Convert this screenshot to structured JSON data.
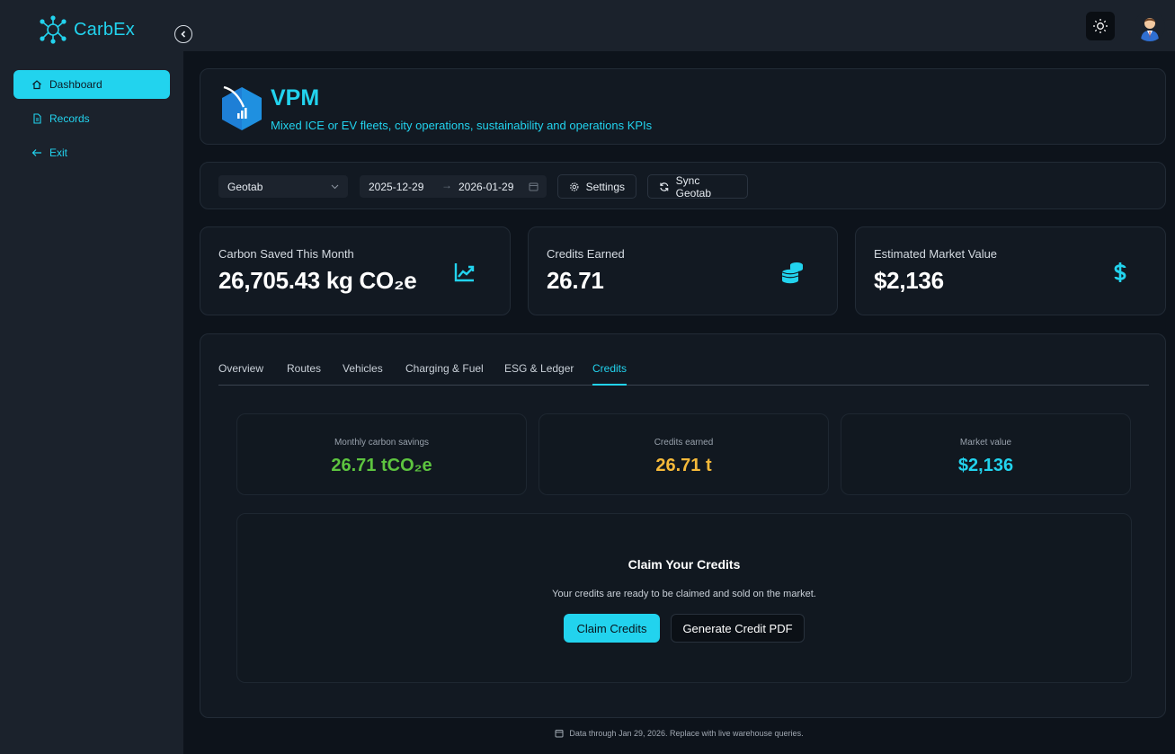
{
  "app": {
    "name": "CarbEx",
    "accent": "#22d3ee",
    "icons": {
      "logo": "network-molecule-icon",
      "collapse": "chevron-left-icon",
      "theme": "sun-icon",
      "avatar": "user-avatar"
    }
  },
  "sidebar": {
    "items": [
      {
        "label": "Dashboard",
        "icon": "home-icon",
        "active": true
      },
      {
        "label": "Records",
        "icon": "document-icon",
        "active": false
      },
      {
        "label": "Exit",
        "icon": "arrow-left-icon",
        "active": false
      }
    ]
  },
  "header": {
    "title": "VPM",
    "subtitle": "Mixed ICE or EV fleets, city operations, sustainability and operations KPIs"
  },
  "filters": {
    "source": "Geotab",
    "date_start": "2025-12-29",
    "date_end": "2026-01-29",
    "date_separator": "→",
    "settings_label": "Settings",
    "sync_label": "Sync Geotab"
  },
  "stats": [
    {
      "label": "Carbon Saved This Month",
      "value": "26,705.43 kg CO₂e",
      "icon": "trend-up-icon"
    },
    {
      "label": "Credits Earned",
      "value": "26.71",
      "icon": "coins-icon"
    },
    {
      "label": "Estimated Market Value",
      "value": "$2,136",
      "icon": "dollar-icon"
    }
  ],
  "tabs": [
    {
      "label": "Overview",
      "active": false
    },
    {
      "label": "Routes",
      "active": false
    },
    {
      "label": "Vehicles",
      "active": false
    },
    {
      "label": "Charging & Fuel",
      "active": false
    },
    {
      "label": "ESG & Ledger",
      "active": false
    },
    {
      "label": "Credits",
      "active": true
    }
  ],
  "credits": {
    "summary": [
      {
        "label": "Monthly carbon savings",
        "value": "26.71 tCO₂e",
        "color": "#5dc43f"
      },
      {
        "label": "Credits earned",
        "value": "26.71 t",
        "color": "#f5b93a"
      },
      {
        "label": "Market value",
        "value": "$2,136",
        "color": "#22d3ee"
      }
    ],
    "claim": {
      "title": "Claim Your Credits",
      "description": "Your credits are ready to be claimed and sold on the market.",
      "primary_label": "Claim Credits",
      "secondary_label": "Generate Credit PDF"
    }
  },
  "footer": {
    "text": "Data through Jan 29, 2026. Replace with live warehouse queries.",
    "icon": "calendar-icon"
  }
}
